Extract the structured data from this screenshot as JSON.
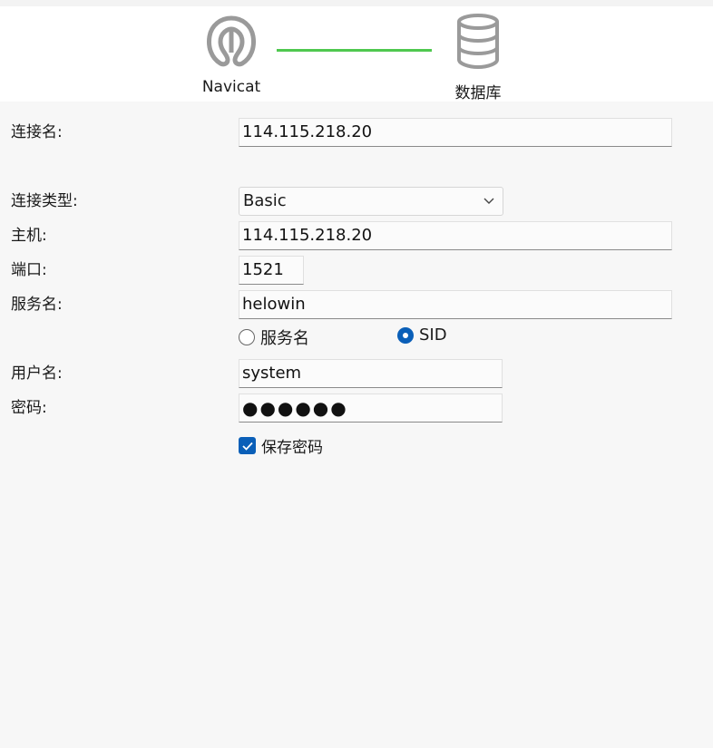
{
  "header": {
    "app_label": "Navicat",
    "db_label": "数据库",
    "line_color": "#4fc84f",
    "app_icon": "navicat-logo-icon",
    "db_icon": "database-icon"
  },
  "form": {
    "connection_name_label": "连接名:",
    "connection_name_value": "114.115.218.20",
    "connection_type_label": "连接类型:",
    "connection_type_value": "Basic",
    "host_label": "主机:",
    "host_value": "114.115.218.20",
    "port_label": "端口:",
    "port_value": "1521",
    "service_name_label": "服务名:",
    "service_name_value": "helowin",
    "radio_service_name": "服务名",
    "radio_sid": "SID",
    "radio_selected": "SID",
    "username_label": "用户名:",
    "username_value": "system",
    "password_label": "密码:",
    "password_masked": "●●●●●●",
    "save_password_label": "保存密码",
    "save_password_checked": true
  },
  "colors": {
    "accent": "#0a5fb8"
  }
}
